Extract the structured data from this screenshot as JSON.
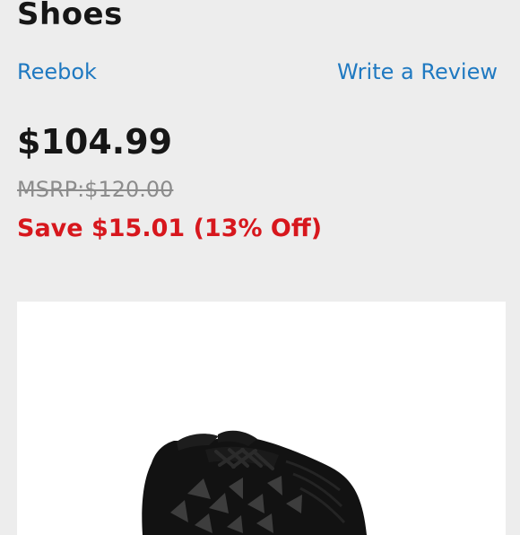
{
  "product": {
    "title": "Shoes",
    "brand": "Reebok",
    "review_link": "Write a Review",
    "price": "$104.99",
    "msrp": "MSRP:$120.00",
    "savings": "Save $15.01 (13% Off)"
  },
  "colors": {
    "background": "#ededed",
    "link": "#1f79c1",
    "savings": "#d7171d",
    "text": "#161616",
    "muted": "#8c8c8c"
  },
  "image": {
    "icon": "black-sneaker-image"
  }
}
